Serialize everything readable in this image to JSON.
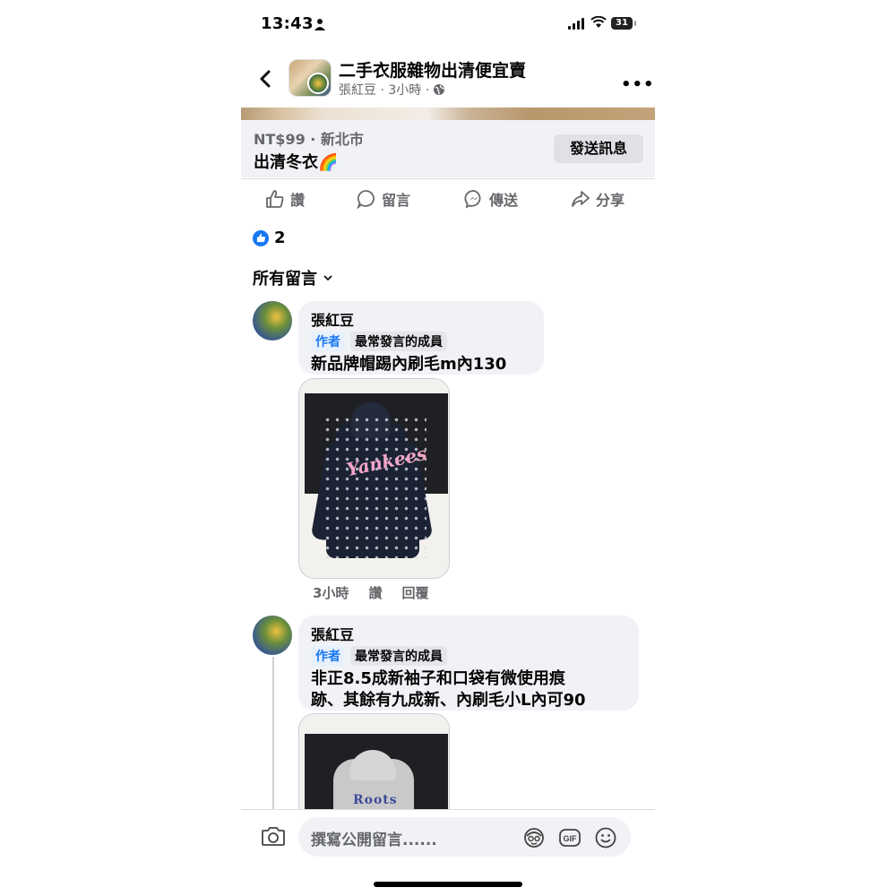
{
  "status_bar": {
    "time": "13:43",
    "battery": "31"
  },
  "header": {
    "group_name": "二手衣服雜物出清便宜賣",
    "meta": "張紅豆 · 3小時 ·"
  },
  "listing": {
    "price_location": "NT$99 · 新北市",
    "title": "出清冬衣🌈",
    "send_button": "發送訊息"
  },
  "actions": {
    "like": "讚",
    "comment": "留言",
    "send": "傳送",
    "share": "分享"
  },
  "reactions": {
    "count": "2"
  },
  "comments_filter": "所有留言",
  "comments": [
    {
      "author": "張紅豆",
      "tags": [
        "作者",
        "最常發言的成員"
      ],
      "text_lines": [
        "新品牌帽踢內刷毛m內130"
      ],
      "meta": {
        "time": "3小時",
        "like": "讚",
        "reply": "回覆"
      },
      "image_text": "Yankees"
    },
    {
      "author": "張紅豆",
      "tags": [
        "作者",
        "最常發言的成員"
      ],
      "text_lines": [
        "非正8.5成新袖子和口袋有微使用痕",
        "跡、其餘有九成新、內刷毛小L內可90"
      ],
      "image_text": "Roots"
    }
  ],
  "composer": {
    "placeholder": "撰寫公開留言......"
  },
  "colors": {
    "accent": "#1877f2",
    "bubble": "#f0f2f5",
    "secondary_text": "#65676b"
  }
}
